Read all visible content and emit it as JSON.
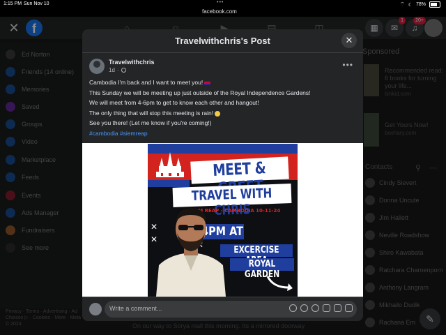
{
  "status_bar": {
    "time": "1:15 PM",
    "date": "Sun Nov 10",
    "url": "facebook.com",
    "battery": "78%"
  },
  "top_nav": {
    "messenger_badge": "1",
    "notifications_badge": "20+"
  },
  "sidebar": {
    "items": [
      {
        "label": "Ed Norton",
        "icon": "avatar",
        "color": "#555555"
      },
      {
        "label": "Friends (14 online)",
        "icon": "friends-icon",
        "color": "#1877f2"
      },
      {
        "label": "Memories",
        "icon": "memories-icon",
        "color": "#1877f2"
      },
      {
        "label": "Saved",
        "icon": "saved-icon",
        "color": "#a033ff"
      },
      {
        "label": "Groups",
        "icon": "groups-icon",
        "color": "#1877f2"
      },
      {
        "label": "Video",
        "icon": "video-icon",
        "color": "#1877f2"
      },
      {
        "label": "Marketplace",
        "icon": "marketplace-icon",
        "color": "#1877f2"
      },
      {
        "label": "Feeds",
        "icon": "feeds-icon",
        "color": "#1877f2"
      },
      {
        "label": "Events",
        "icon": "events-icon",
        "color": "#e41e3f"
      },
      {
        "label": "Ads Manager",
        "icon": "ads-manager-icon",
        "color": "#1877f2"
      },
      {
        "label": "Fundraisers",
        "icon": "fundraisers-icon",
        "color": "#f7923a"
      },
      {
        "label": "See more",
        "icon": "chevron-down-icon",
        "color": "#3a3b3c"
      }
    ],
    "footer": "Privacy · Terms · Advertising · Ad Choices ▷ · Cookies · More · Meta © 2024"
  },
  "right_column": {
    "sponsored_title": "Sponsored",
    "ads": [
      {
        "text": "Recommended read: 6 books for turning your life...",
        "source": "tiinkid.com"
      },
      {
        "text": "Get Yours Now!",
        "source": "boshary.com"
      }
    ],
    "contacts_heading": "Contacts",
    "contacts": [
      "Cindy Sievert",
      "Donna Uncute",
      "Jim Hallett",
      "Neville Roadshow",
      "Shiro Kawabata",
      "Ratchara Charoenporn",
      "Anthony Langram",
      "Mikhailo Dudik",
      "Rachana Em"
    ]
  },
  "feed_snippet": "On our way to Sorya mall this morning. Its a mirrored doorway",
  "modal": {
    "title": "Travelwithchris's Post",
    "author": "Travelwithchris",
    "timestamp": "1d",
    "body_lines": [
      "Cambodia I'm back and I want to meet you!",
      "This Sunday we will be meeting up just outside of the Royal Independence Gardens!",
      "We will meet from 4-6pm to get to know each other and hangout!",
      "The only thing that will stop this meeting is rain!",
      "See you there! (Let me know if you're coming!)"
    ],
    "hashtags": "#cambodia #siemreap",
    "image": {
      "headline": "MEET & GREET",
      "subheadline": "TRAVEL WITH CHRIS",
      "location_date": "SIEM REAP - CAMBODIA 10-11-24",
      "time": "4PM AT",
      "place_line1": "EXCERCISE AREA",
      "place_line2": "ROYAL GARDEN"
    },
    "comment_placeholder": "Write a comment..."
  },
  "colors": {
    "accent": "#1877f2",
    "badge_red": "#e41e3f",
    "hashtag": "#4599ff",
    "poster_blue": "#1f3e9e",
    "poster_red": "#d3231f"
  }
}
